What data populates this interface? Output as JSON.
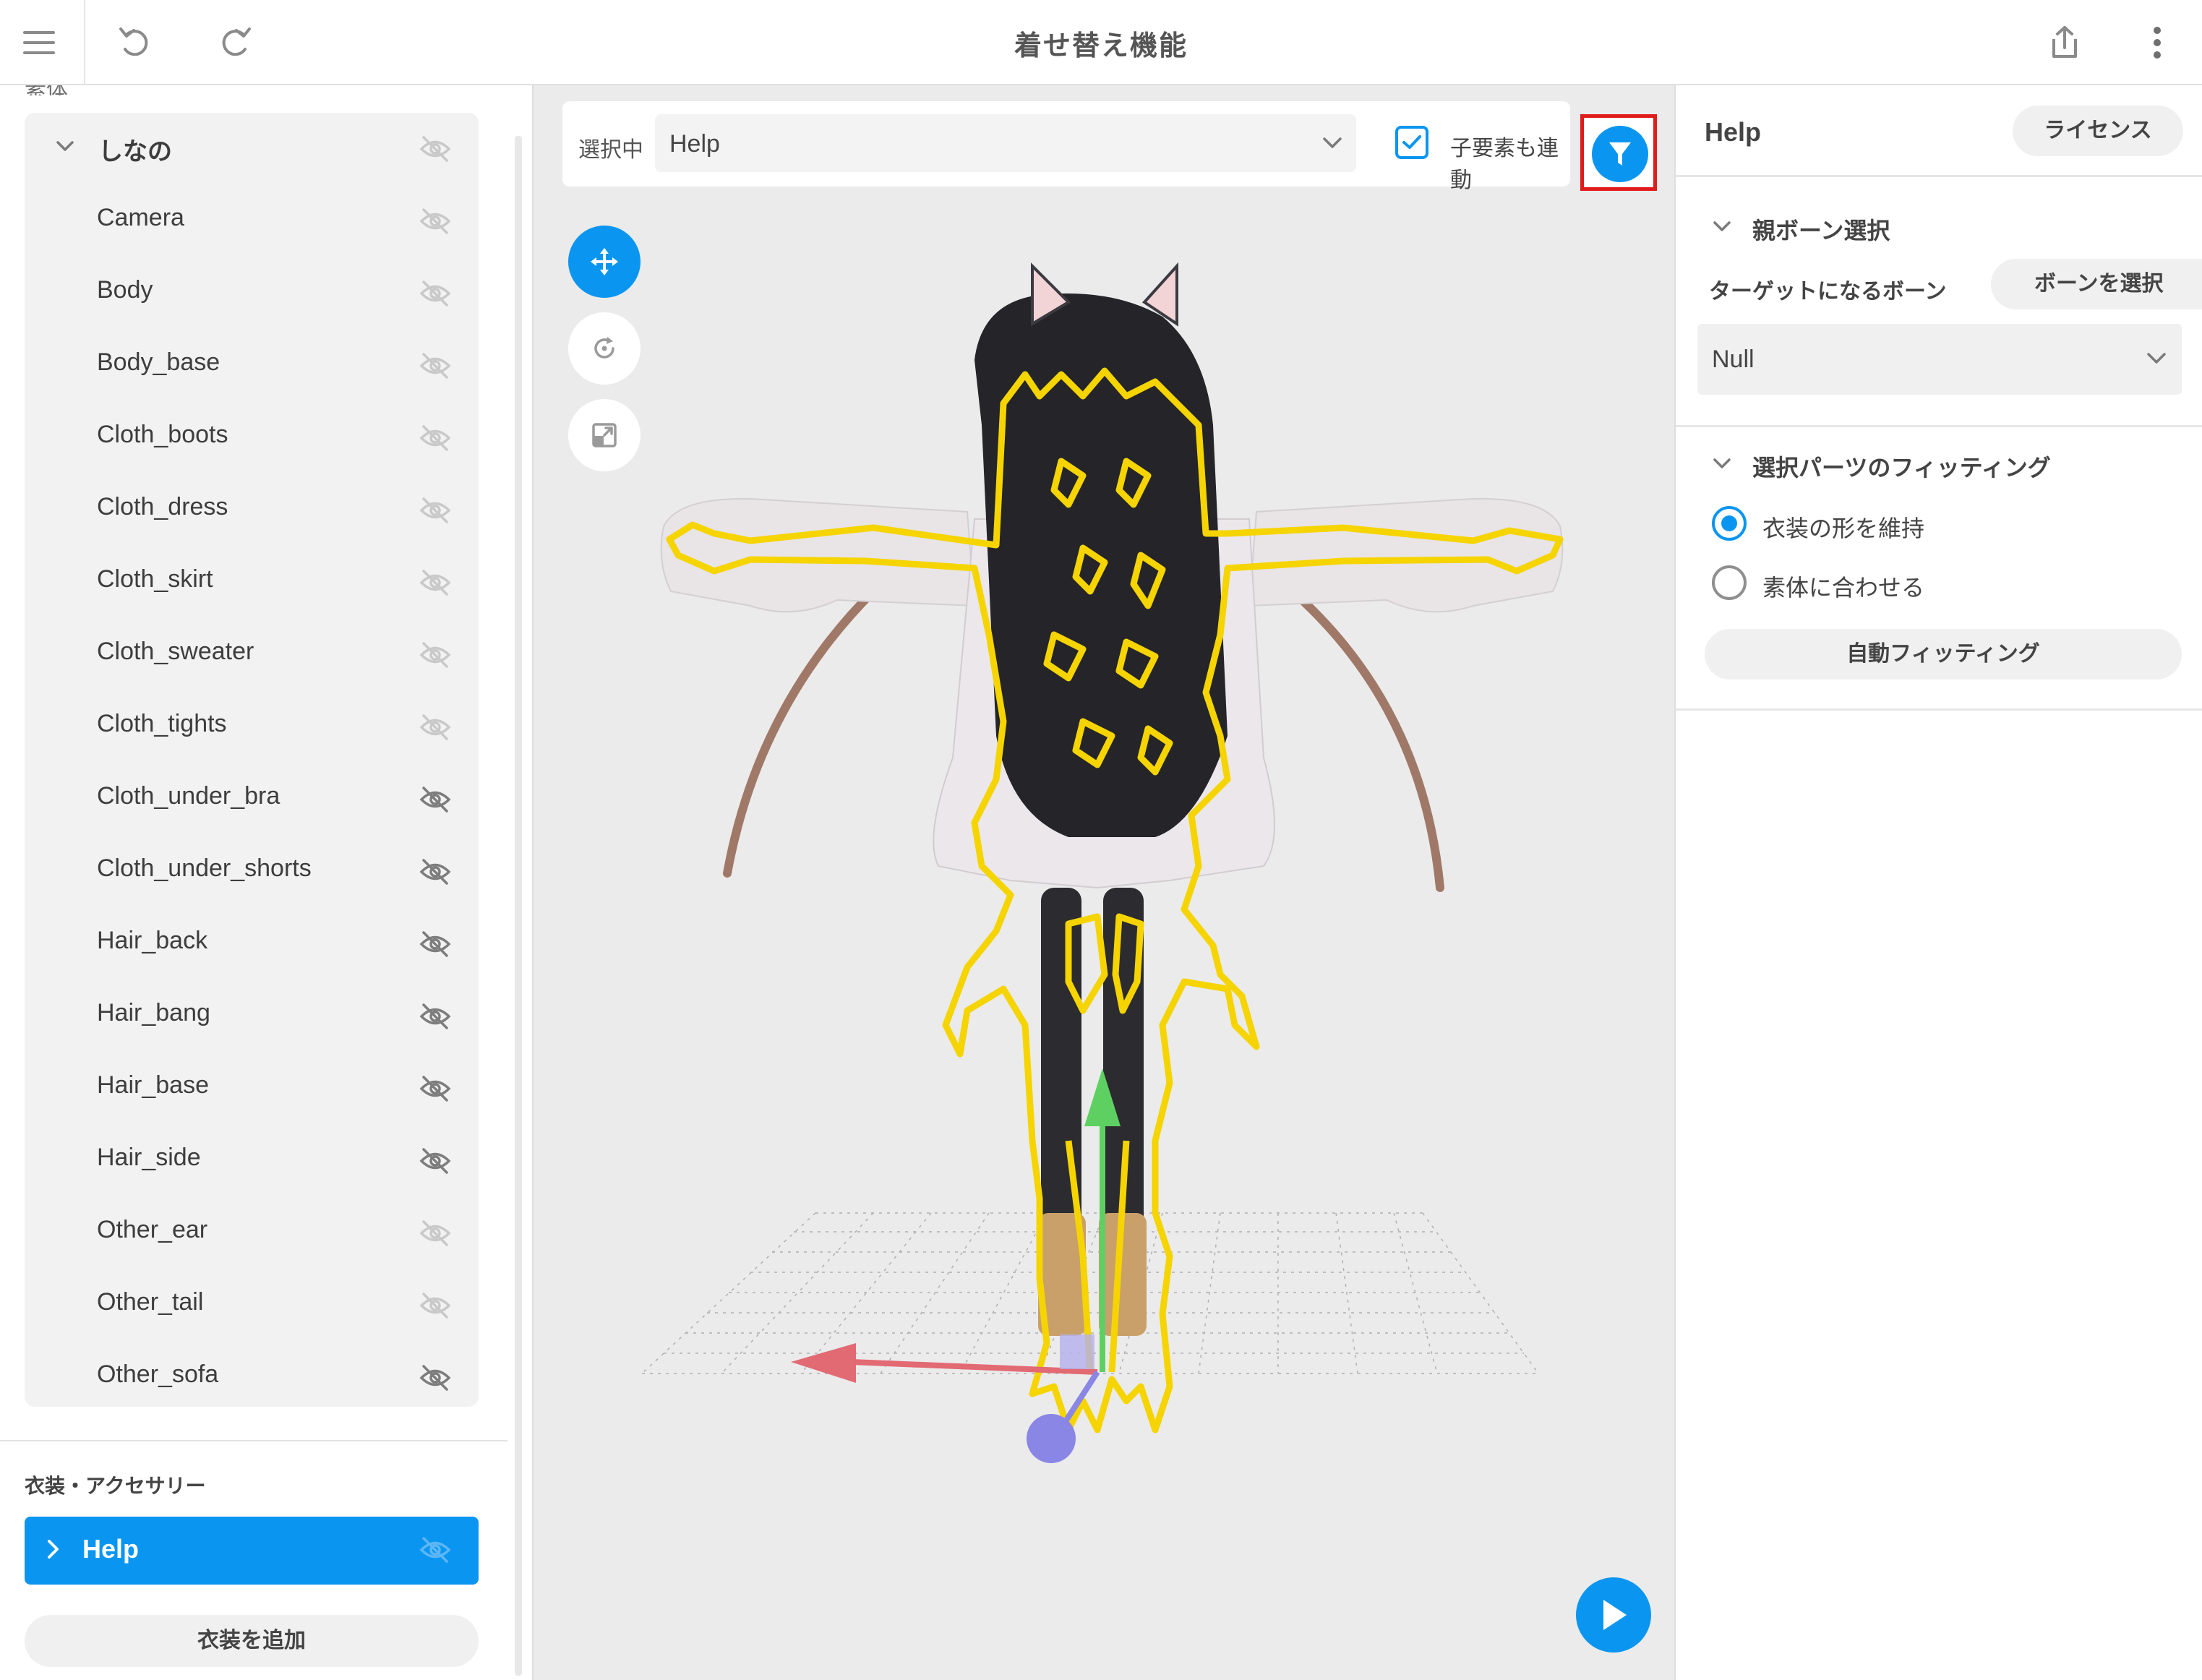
{
  "app": {
    "title": "着せ替え機能"
  },
  "toolbar": {
    "menu_icon": "hamburger-icon",
    "undo_icon": "undo-icon",
    "redo_icon": "redo-icon",
    "share_icon": "share-icon",
    "more_icon": "more-vert-icon"
  },
  "left_panel": {
    "clipped_label": "素体",
    "body_list": {
      "root": {
        "label": "しなの",
        "expanded": true
      },
      "items": [
        {
          "label": "Camera",
          "hidden_icon_strong": false
        },
        {
          "label": "Body",
          "hidden_icon_strong": false
        },
        {
          "label": "Body_base",
          "hidden_icon_strong": false
        },
        {
          "label": "Cloth_boots",
          "hidden_icon_strong": false
        },
        {
          "label": "Cloth_dress",
          "hidden_icon_strong": false
        },
        {
          "label": "Cloth_skirt",
          "hidden_icon_strong": false
        },
        {
          "label": "Cloth_sweater",
          "hidden_icon_strong": false
        },
        {
          "label": "Cloth_tights",
          "hidden_icon_strong": false
        },
        {
          "label": "Cloth_under_bra",
          "hidden_icon_strong": true
        },
        {
          "label": "Cloth_under_shorts",
          "hidden_icon_strong": true
        },
        {
          "label": "Hair_back",
          "hidden_icon_strong": true
        },
        {
          "label": "Hair_bang",
          "hidden_icon_strong": true
        },
        {
          "label": "Hair_base",
          "hidden_icon_strong": true
        },
        {
          "label": "Hair_side",
          "hidden_icon_strong": true
        },
        {
          "label": "Other_ear",
          "hidden_icon_strong": false
        },
        {
          "label": "Other_tail",
          "hidden_icon_strong": false
        },
        {
          "label": "Other_sofa",
          "hidden_icon_strong": true
        }
      ]
    },
    "accessory_section": {
      "title": "衣装・アクセサリー",
      "items": [
        {
          "label": "Help",
          "selected": true
        }
      ],
      "add_button": "衣装を追加"
    }
  },
  "viewport": {
    "selection_label": "選択中",
    "selection_value": "Help",
    "child_link": {
      "label": "子要素も連動",
      "checked": true
    },
    "filter_icon": "filter-icon",
    "tools": [
      {
        "name": "move",
        "icon": "move-icon",
        "active": true
      },
      {
        "name": "rotate",
        "icon": "rotate-icon",
        "active": false
      },
      {
        "name": "scale",
        "icon": "scale-icon",
        "active": false
      }
    ],
    "play_icon": "play-icon"
  },
  "right_panel": {
    "title": "Help",
    "license_button": "ライセンス",
    "parent_bone_section": {
      "title": "親ボーン選択",
      "target_label": "ターゲットになるボーン",
      "select_button": "ボーンを選択",
      "bone_value": "Null"
    },
    "fitting_section": {
      "title": "選択パーツのフィッティング",
      "options": [
        {
          "label": "衣装の形を維持",
          "selected": true
        },
        {
          "label": "素体に合わせる",
          "selected": false
        }
      ],
      "auto_fit_button": "自動フィッティング"
    }
  },
  "colors": {
    "accent": "#0a96f0",
    "highlight": "#e01b1b",
    "outline": "#f5d400"
  }
}
